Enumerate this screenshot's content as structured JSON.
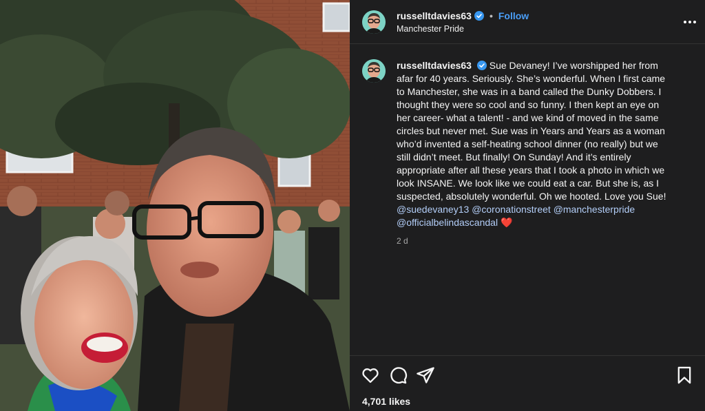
{
  "post": {
    "username": "russelltdavies63",
    "follow_label": "Follow",
    "separator": "•",
    "location": "Manchester Pride",
    "more_label": "•••",
    "caption_username": "russelltdavies63",
    "caption_text": "Sue Devaney! I’ve worshipped her from afar for 40 years. Seriously. She’s wonderful. When I first came to Manchester, she was in a band called the Dunky Dobbers. I thought they were so cool and so funny. I then kept an eye on her career- what a talent! - and we kind of moved in the same circles but never met. Sue was in Years and Years as a woman who’d invented a self-heating school dinner (no really) but we still didn’t meet. But finally! On Sunday! And it’s entirely appropriate after all these years that I took a photo in which we look INSANE. We look like we could eat a car. But she is, as I suspected, absolutely wonderful. Oh we hooted. Love you Sue!",
    "mentions": [
      "@suedevaney13",
      "@coronationstreet",
      "@manchesterpride",
      "@officialbelindascandal"
    ],
    "heart_emoji": "❤️",
    "time_ago": "2 d",
    "likes": "4,701 likes"
  },
  "icons": {
    "like": "heart-icon",
    "comment": "comment-icon",
    "share": "share-icon",
    "save": "bookmark-icon",
    "verified": "verified-badge-icon",
    "more": "more-options-icon"
  },
  "colors": {
    "panel_bg": "#1e1e1f",
    "link": "#4a9ef7",
    "mention": "#b3cef8",
    "verified": "#3897f0",
    "heart": "#e0245e"
  }
}
